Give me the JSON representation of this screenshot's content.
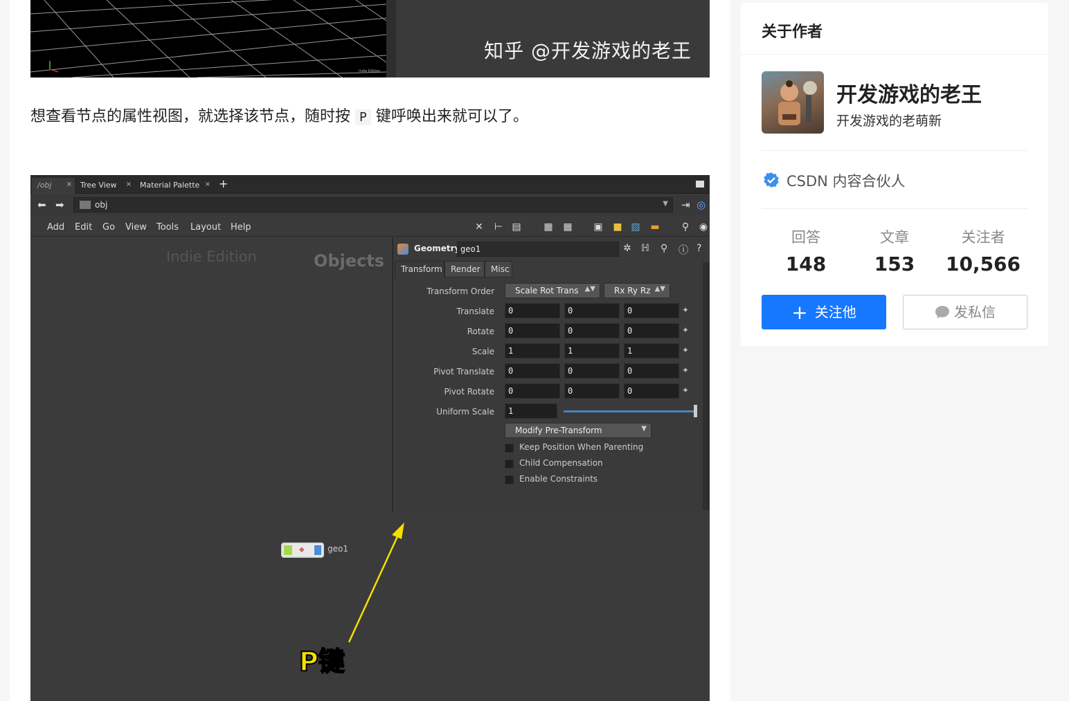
{
  "top_image": {
    "watermark": "知乎 @开发游戏的老王",
    "tiny_text": "Indie Edition"
  },
  "paragraph": {
    "before": "想查看节点的属性视图，就选择该节点，随时按",
    "key": "P",
    "after": "键呼唤出来就可以了。"
  },
  "houdini": {
    "tabs": [
      {
        "label": "/obj"
      },
      {
        "label": "Tree View"
      },
      {
        "label": "Material Palette"
      }
    ],
    "path": "obj",
    "menu": [
      "Add",
      "Edit",
      "Go",
      "View",
      "Tools",
      "Layout",
      "Help"
    ],
    "watermark_edition": "Indie Edition",
    "watermark_context": "Objects",
    "node": {
      "name": "geo1"
    },
    "params": {
      "node_type": "Geometry",
      "node_name": "geo1",
      "tabs": [
        "Transform",
        "Render",
        "Misc"
      ],
      "transform_order": {
        "label": "Transform Order",
        "value": "Scale Rot Trans",
        "rot_order": "Rx Ry Rz"
      },
      "rows": [
        {
          "label": "Translate",
          "values": [
            "0",
            "0",
            "0"
          ]
        },
        {
          "label": "Rotate",
          "values": [
            "0",
            "0",
            "0"
          ]
        },
        {
          "label": "Scale",
          "values": [
            "1",
            "1",
            "1"
          ]
        },
        {
          "label": "Pivot Translate",
          "values": [
            "0",
            "0",
            "0"
          ]
        },
        {
          "label": "Pivot Rotate",
          "values": [
            "0",
            "0",
            "0"
          ]
        }
      ],
      "uniform_scale": {
        "label": "Uniform Scale",
        "value": "1"
      },
      "modify_pre_transform": "Modify Pre-Transform",
      "checkboxes": [
        "Keep Position When Parenting",
        "Child Compensation",
        "Enable Constraints"
      ]
    },
    "annotation": "P键",
    "accent_color": "#f5e000"
  },
  "sidebar": {
    "title": "关于作者",
    "author_name": "开发游戏的老王",
    "author_desc": "开发游戏的老萌新",
    "partner": "CSDN 内容合伙人",
    "stats": [
      {
        "label": "回答",
        "value": "148"
      },
      {
        "label": "文章",
        "value": "153"
      },
      {
        "label": "关注者",
        "value": "10,566"
      }
    ],
    "follow_label": "关注他",
    "message_label": "发私信",
    "brand_color": "#1677ff"
  }
}
